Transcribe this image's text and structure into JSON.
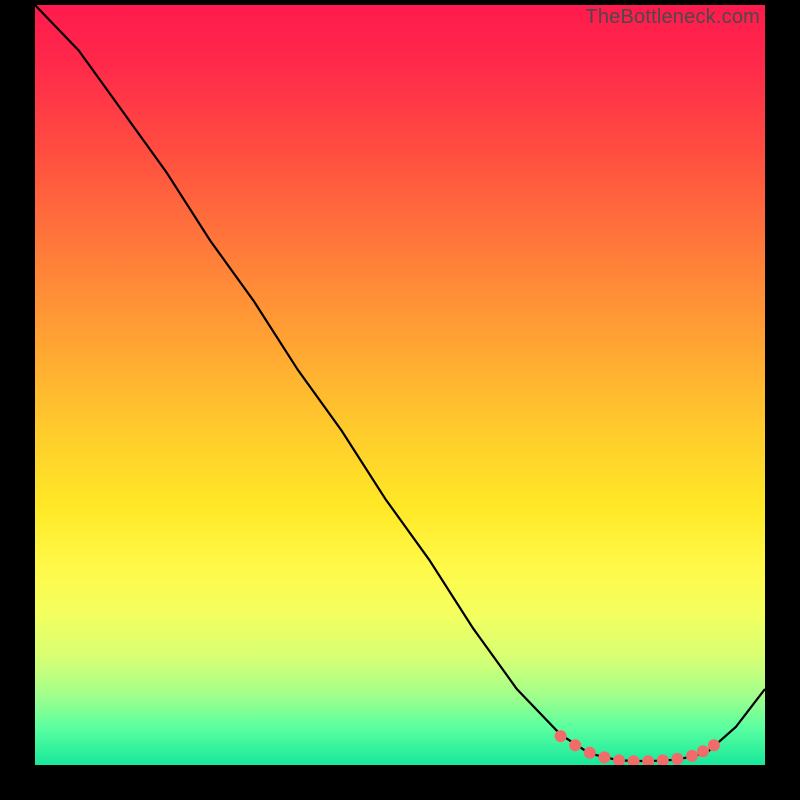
{
  "watermark": "TheBottleneck.com",
  "chart_data": {
    "type": "line",
    "title": "",
    "xlabel": "",
    "ylabel": "",
    "xlim": [
      0,
      100
    ],
    "ylim": [
      0,
      100
    ],
    "series": [
      {
        "name": "curve",
        "x": [
          0,
          6,
          12,
          18,
          24,
          30,
          36,
          42,
          48,
          54,
          60,
          66,
          72,
          76,
          80,
          84,
          88,
          92,
          96,
          100
        ],
        "y": [
          100,
          94,
          86,
          78,
          69,
          61,
          52,
          44,
          35,
          27,
          18,
          10,
          4,
          1.5,
          0.6,
          0.5,
          0.7,
          1.6,
          5,
          10
        ]
      }
    ],
    "markers": {
      "name": "highlight",
      "color": "#f26b6b",
      "x": [
        72,
        74,
        76,
        78,
        80,
        82,
        84,
        86,
        88,
        90,
        91.5,
        93
      ],
      "y": [
        3.8,
        2.6,
        1.6,
        1.0,
        0.6,
        0.5,
        0.5,
        0.6,
        0.8,
        1.2,
        1.8,
        2.6
      ]
    }
  }
}
